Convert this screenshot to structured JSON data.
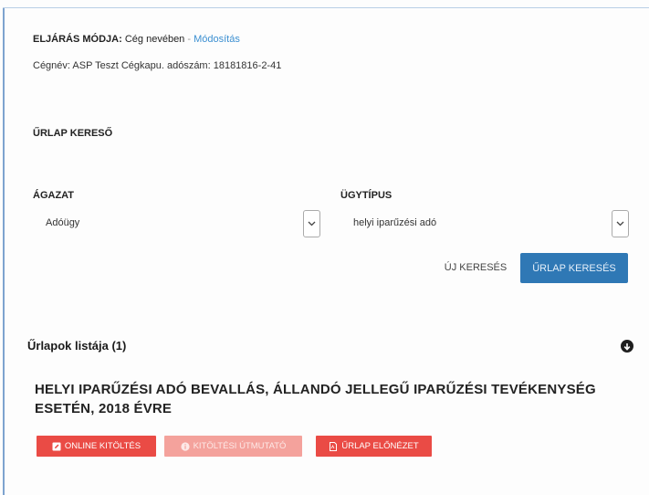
{
  "procedure": {
    "label": "ELJÁRÁS MÓDJA:",
    "value": "Cég nevében",
    "separator": " - ",
    "modify_link": "Módosítás"
  },
  "company_line": "Cégnév: ASP Teszt Cégkapu. adószám: 18181816-2-41",
  "form_search": {
    "title": "ŰRLAP KERESŐ",
    "sector": {
      "label": "ÁGAZAT",
      "value": "Adóügy"
    },
    "case_type": {
      "label": "ÜGYTÍPUS",
      "value": "helyi iparűzési adó"
    },
    "new_search_label": "ÚJ KERESÉS",
    "search_label": "ŰRLAP KERESÉS"
  },
  "form_list": {
    "title": "Űrlapok listája (1)",
    "items": [
      {
        "title": "HELYI IPARŰZÉSI ADÓ BEVALLÁS, ÁLLANDÓ JELLEGŰ IPARŰZÉSI TEVÉKENYSÉG ESETÉN, 2018 ÉVRE",
        "online_label": "ONLINE KITÖLTÉS",
        "guide_label": "KITÖLTÉSI ÚTMUTATÓ",
        "preview_label": "ŰRLAP ELŐNÉZET"
      }
    ]
  },
  "colors": {
    "accent_blue": "#2f78b5",
    "link_blue": "#3b8fd1",
    "action_red": "#ea4b45",
    "action_red_light": "#f4a29c"
  },
  "icons": {
    "online": "edit-icon",
    "guide": "info-icon",
    "preview": "pdf-icon",
    "toggle": "arrow-down-circle-icon"
  }
}
